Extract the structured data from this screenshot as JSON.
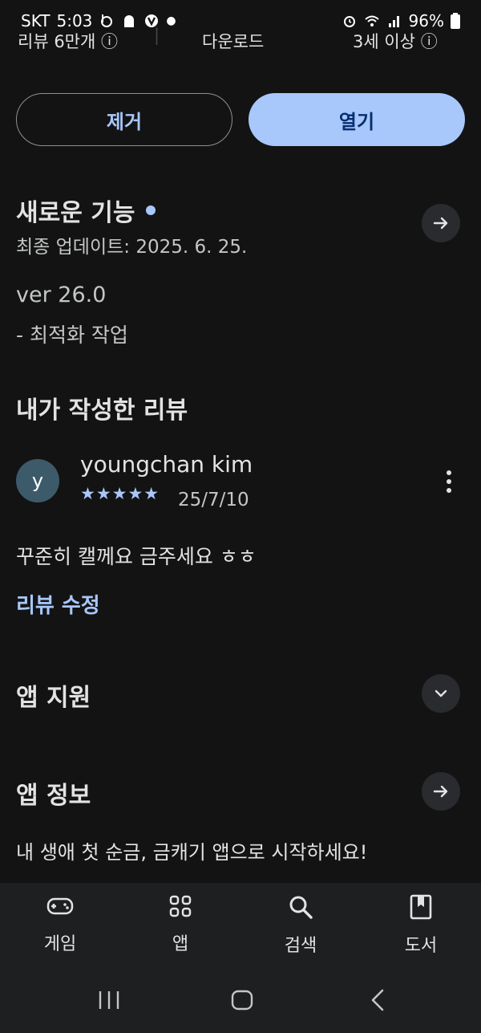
{
  "status_bar": {
    "carrier": "SKT",
    "time": "5:03",
    "battery": "96%"
  },
  "stats_row": {
    "reviews": "리뷰 6만개",
    "downloads": "다운로드",
    "age": "3세 이상"
  },
  "actions": {
    "remove_label": "제거",
    "open_label": "열기"
  },
  "whats_new": {
    "title": "새로운 기능",
    "updated": "최종 업데이트: 2025. 6. 25.",
    "version": "ver 26.0",
    "note": "- 최적화 작업"
  },
  "my_review": {
    "title": "내가 작성한 리뷰",
    "avatar_initial": "y",
    "user": "youngchan kim",
    "rating": 5,
    "stars": "★★★★★",
    "date": "25/7/10",
    "text": "꾸준히 캘께요 금주세요 ㅎㅎ",
    "edit_label": "리뷰 수정"
  },
  "app_support": {
    "title": "앱 지원"
  },
  "app_info": {
    "title": "앱 정보",
    "description": "내 생애 첫 순금, 금캐기 앱으로 시작하세요!"
  },
  "bottom_nav": [
    {
      "label": "게임",
      "icon": "gamepad-icon"
    },
    {
      "label": "앱",
      "icon": "apps-grid-icon"
    },
    {
      "label": "검색",
      "icon": "search-icon"
    },
    {
      "label": "도서",
      "icon": "book-icon"
    }
  ],
  "colors": {
    "background": "#131314",
    "accent": "#a8c7fa",
    "open_button_text": "#062e6f"
  }
}
